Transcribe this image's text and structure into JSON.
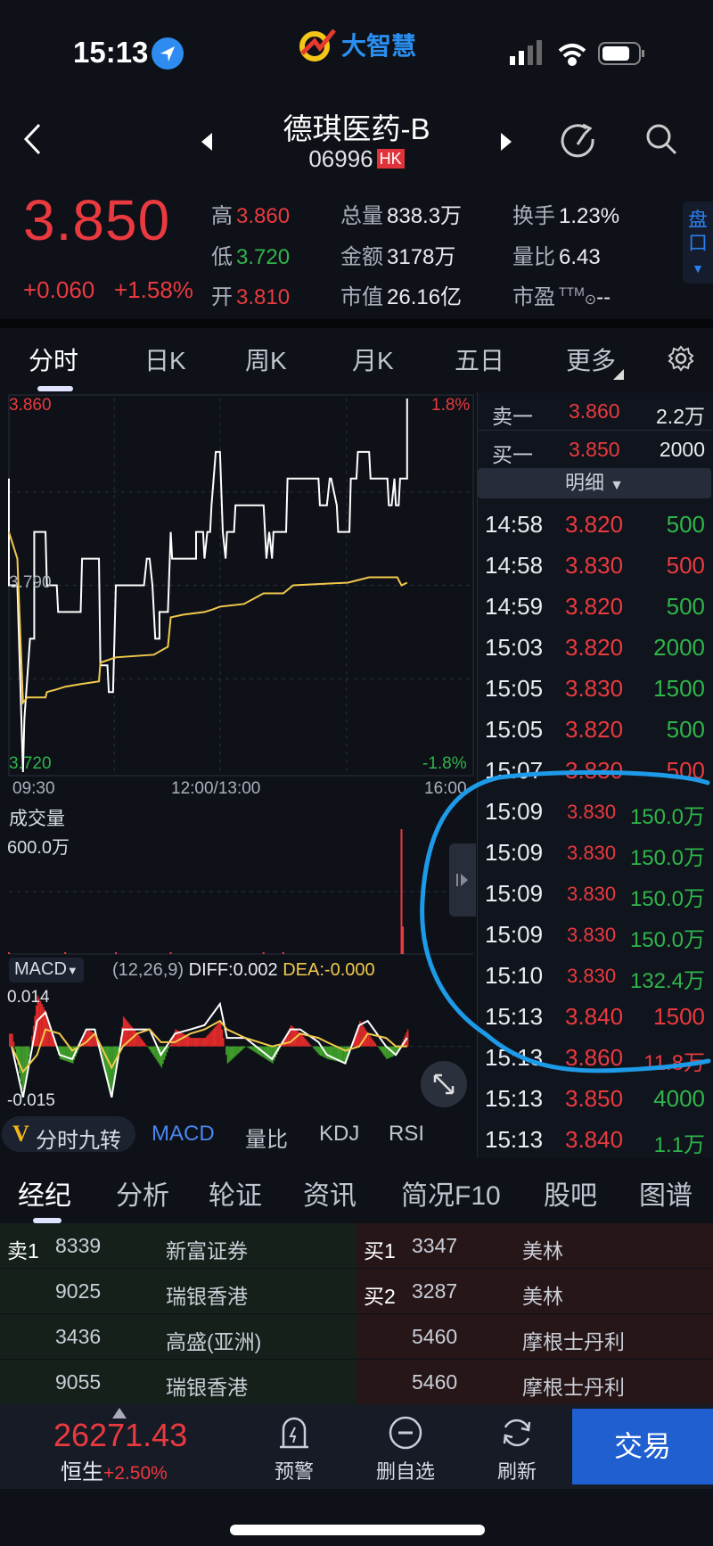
{
  "status": {
    "time": "15:13",
    "app_logo": "大智慧"
  },
  "header": {
    "name": "德琪医药-B",
    "code": "06996",
    "market": "HK"
  },
  "quote": {
    "price": "3.850",
    "change": "+0.060",
    "change_pct": "+1.58%",
    "stats": [
      {
        "label": "高",
        "value": "3.860",
        "color": "red"
      },
      {
        "label": "低",
        "value": "3.720",
        "color": "green"
      },
      {
        "label": "开",
        "value": "3.810",
        "color": "red"
      },
      {
        "label": "总量",
        "value": "838.3万",
        "color": "white"
      },
      {
        "label": "金额",
        "value": "3178万",
        "color": "white"
      },
      {
        "label": "市值",
        "value": "26.16亿",
        "color": "white"
      },
      {
        "label": "换手",
        "value": "1.23%",
        "color": "white"
      },
      {
        "label": "量比",
        "value": "6.43",
        "color": "white"
      },
      {
        "label": "市盈",
        "value": "--",
        "color": "white",
        "sup": "TTM"
      }
    ],
    "side_tab": "盘口"
  },
  "chart_tabs": [
    "分时",
    "日K",
    "周K",
    "月K",
    "五日",
    "更多"
  ],
  "chart_data": [
    {
      "type": "line",
      "y_labels": {
        "top": "3.860",
        "mid": "3.790",
        "bottom": "3.720",
        "top_pct": "1.8%",
        "bottom_pct": "-1.8%"
      },
      "x_labels": [
        "09:30",
        "12:00/13:00",
        "16:00"
      ],
      "ylim": [
        3.72,
        3.86
      ],
      "series": [
        {
          "color": "#ffffff",
          "points": [
            [
              "09:30",
              3.83
            ],
            [
              "09:30",
              3.79
            ],
            [
              "09:36",
              3.79
            ],
            [
              "09:40",
              3.72
            ],
            [
              "09:41",
              3.74
            ],
            [
              "09:45",
              3.77
            ],
            [
              "09:48",
              3.77
            ],
            [
              "09:48",
              3.81
            ],
            [
              "09:56",
              3.81
            ],
            [
              "09:57",
              3.79
            ],
            [
              "10:04",
              3.79
            ],
            [
              "10:05",
              3.78
            ],
            [
              "10:21",
              3.78
            ],
            [
              "10:22",
              3.8
            ],
            [
              "10:34",
              3.8
            ],
            [
              "10:35",
              3.76
            ],
            [
              "10:40",
              3.76
            ],
            [
              "10:41",
              3.75
            ],
            [
              "10:44",
              3.75
            ],
            [
              "10:46",
              3.79
            ],
            [
              "11:06",
              3.79
            ],
            [
              "11:08",
              3.8
            ],
            [
              "11:10",
              3.8
            ],
            [
              "11:12",
              3.79
            ],
            [
              "11:14",
              3.77
            ],
            [
              "11:17",
              3.77
            ],
            [
              "11:17",
              3.78
            ],
            [
              "11:23",
              3.78
            ],
            [
              "11:25",
              3.81
            ],
            [
              "11:26",
              3.8
            ],
            [
              "11:43",
              3.8
            ],
            [
              "11:43",
              3.81
            ],
            [
              "11:48",
              3.81
            ],
            [
              "11:49",
              3.8
            ],
            [
              "11:51",
              3.81
            ],
            [
              "11:53",
              3.81
            ],
            [
              "11:54",
              3.82
            ],
            [
              "11:57",
              3.84
            ],
            [
              "13:00",
              3.84
            ],
            [
              "13:02",
              3.81
            ],
            [
              "13:04",
              3.8
            ],
            [
              "13:05",
              3.81
            ],
            [
              "13:10",
              3.81
            ],
            [
              "13:11",
              3.82
            ],
            [
              "13:31",
              3.82
            ],
            [
              "13:33",
              3.8
            ],
            [
              "13:35",
              3.81
            ],
            [
              "13:37",
              3.8
            ],
            [
              "13:38",
              3.81
            ],
            [
              "13:47",
              3.81
            ],
            [
              "13:48",
              3.83
            ],
            [
              "14:10",
              3.83
            ],
            [
              "14:11",
              3.82
            ],
            [
              "14:16",
              3.82
            ],
            [
              "14:18",
              3.83
            ],
            [
              "14:19",
              3.83
            ],
            [
              "14:23",
              3.82
            ],
            [
              "14:24",
              3.81
            ],
            [
              "14:32",
              3.81
            ],
            [
              "14:33",
              3.83
            ],
            [
              "14:37",
              3.83
            ],
            [
              "14:38",
              3.84
            ],
            [
              "14:46",
              3.84
            ],
            [
              "14:47",
              3.83
            ],
            [
              "14:59",
              3.83
            ],
            [
              "15:00",
              3.82
            ],
            [
              "15:02",
              3.82
            ],
            [
              "15:04",
              3.83
            ],
            [
              "15:05",
              3.82
            ],
            [
              "15:07",
              3.82
            ],
            [
              "15:08",
              3.83
            ],
            [
              "15:13",
              3.83
            ],
            [
              "15:13",
              3.86
            ]
          ]
        },
        {
          "color": "#f2c94c",
          "points": [
            [
              "09:30",
              3.81
            ],
            [
              "09:36",
              3.8
            ],
            [
              "09:40",
              3.746
            ],
            [
              "09:43",
              3.748
            ],
            [
              "09:56",
              3.748
            ],
            [
              "09:57",
              3.75
            ],
            [
              "10:04",
              3.751
            ],
            [
              "10:10",
              3.752
            ],
            [
              "10:21",
              3.753
            ],
            [
              "10:34",
              3.754
            ],
            [
              "10:35",
              3.761
            ],
            [
              "10:46",
              3.763
            ],
            [
              "11:13",
              3.764
            ],
            [
              "11:23",
              3.767
            ],
            [
              "11:25",
              3.778
            ],
            [
              "11:34",
              3.779
            ],
            [
              "11:49",
              3.78
            ],
            [
              "11:55",
              3.781
            ],
            [
              "13:00",
              3.782
            ],
            [
              "13:17",
              3.783
            ],
            [
              "13:31",
              3.787
            ],
            [
              "13:45",
              3.787
            ],
            [
              "13:52",
              3.79
            ],
            [
              "14:31",
              3.791
            ],
            [
              "14:46",
              3.793
            ],
            [
              "15:06",
              3.793
            ],
            [
              "15:09",
              3.79
            ],
            [
              "15:13",
              3.791
            ]
          ]
        }
      ]
    },
    {
      "type": "bar",
      "title": "成交量",
      "max_label": "600.0万",
      "ylim": [
        0,
        600
      ],
      "color": "#ea3a3f",
      "bars": [
        [
          "09:30",
          5
        ],
        [
          "10:10",
          4
        ],
        [
          "10:46",
          8
        ],
        [
          "11:25",
          8
        ],
        [
          "13:31",
          6
        ],
        [
          "13:45",
          6
        ],
        [
          "15:09",
          600
        ],
        [
          "15:10",
          132
        ]
      ]
    },
    {
      "type": "bar",
      "title": "MACD",
      "params": "(12,26,9)",
      "diff_label": "DIFF:0.002",
      "dea_label": "DEA:-0.000",
      "y_labels": {
        "top": "0.014",
        "bottom": "-0.015"
      },
      "ylim": [
        -0.015,
        0.014
      ],
      "colors": {
        "up": "#e02a2a",
        "down": "#3f9e2a",
        "diff": "#ffffff",
        "dea": "#f2c94c"
      },
      "points": [
        [
          "09:32",
          0.003,
          0.0,
          0.0
        ],
        [
          "09:40",
          -0.012,
          -0.012,
          -0.006
        ],
        [
          "09:50",
          0.012,
          0.006,
          -0.002
        ],
        [
          "09:56",
          0.008,
          0.008,
          0.004
        ],
        [
          "10:06",
          -0.003,
          -0.002,
          0.003
        ],
        [
          "10:15",
          -0.004,
          -0.003,
          -0.001
        ],
        [
          "10:25",
          0.004,
          0.004,
          0.001
        ],
        [
          "10:31",
          0.003,
          0.004,
          0.003
        ],
        [
          "10:43",
          -0.012,
          -0.012,
          -0.005
        ],
        [
          "10:51",
          0.007,
          0.004,
          0.0
        ],
        [
          "11:01",
          0.003,
          0.004,
          0.003
        ],
        [
          "11:10",
          -0.001,
          0.004,
          0.004
        ],
        [
          "11:18",
          -0.005,
          -0.002,
          0.001
        ],
        [
          "11:28",
          0.004,
          0.003,
          0.001
        ],
        [
          "11:39",
          0.002,
          0.004,
          0.003
        ],
        [
          "11:49",
          0.002,
          0.005,
          0.004
        ],
        [
          "13:00",
          0.006,
          0.01,
          0.006
        ],
        [
          "13:05",
          -0.004,
          0.002,
          0.004
        ],
        [
          "13:18",
          0.0,
          0.002,
          0.002
        ],
        [
          "13:37",
          -0.004,
          -0.003,
          0.0
        ],
        [
          "13:50",
          0.005,
          0.004,
          0.001
        ],
        [
          "13:57",
          0.003,
          0.004,
          0.003
        ],
        [
          "14:10",
          -0.002,
          0.001,
          0.002
        ],
        [
          "14:16",
          -0.003,
          -0.002,
          0.001
        ],
        [
          "14:29",
          -0.004,
          -0.004,
          -0.001
        ],
        [
          "14:39",
          0.006,
          0.005,
          0.0
        ],
        [
          "14:45",
          0.003,
          0.006,
          0.003
        ],
        [
          "14:58",
          -0.003,
          0.0,
          0.002
        ],
        [
          "15:05",
          -0.002,
          -0.002,
          0.0
        ],
        [
          "15:13",
          0.004,
          0.002,
          0.0
        ]
      ]
    }
  ],
  "orderbook": {
    "sell1": {
      "label": "卖一",
      "price": "3.860",
      "vol": "2.2万"
    },
    "buy1": {
      "label": "买一",
      "price": "3.850",
      "vol": "2000"
    },
    "detail_label": "明细"
  },
  "trades": [
    {
      "time": "14:58",
      "price": "3.820",
      "vol": "500",
      "vol_color": "green"
    },
    {
      "time": "14:58",
      "price": "3.830",
      "vol": "500",
      "vol_color": "red"
    },
    {
      "time": "14:59",
      "price": "3.820",
      "vol": "500",
      "vol_color": "green"
    },
    {
      "time": "15:03",
      "price": "3.820",
      "vol": "2000",
      "vol_color": "green"
    },
    {
      "time": "15:05",
      "price": "3.830",
      "vol": "1500",
      "vol_color": "green"
    },
    {
      "time": "15:05",
      "price": "3.820",
      "vol": "500",
      "vol_color": "green"
    },
    {
      "time": "15:07",
      "price": "3.830",
      "vol": "500",
      "vol_color": "red"
    },
    {
      "time": "15:09",
      "price": "3.830",
      "vol": "150.0万",
      "vol_color": "green"
    },
    {
      "time": "15:09",
      "price": "3.830",
      "vol": "150.0万",
      "vol_color": "green"
    },
    {
      "time": "15:09",
      "price": "3.830",
      "vol": "150.0万",
      "vol_color": "green"
    },
    {
      "time": "15:09",
      "price": "3.830",
      "vol": "150.0万",
      "vol_color": "green"
    },
    {
      "time": "15:10",
      "price": "3.830",
      "vol": "132.4万",
      "vol_color": "green"
    },
    {
      "time": "15:13",
      "price": "3.840",
      "vol": "1500",
      "vol_color": "red"
    },
    {
      "time": "15:13",
      "price": "3.860",
      "vol": "11.8万",
      "vol_color": "red"
    },
    {
      "time": "15:13",
      "price": "3.850",
      "vol": "4000",
      "vol_color": "green"
    },
    {
      "time": "15:13",
      "price": "3.840",
      "vol": "1.1万",
      "vol_color": "green"
    }
  ],
  "indicator_tabs": [
    "分时九转",
    "MACD",
    "量比",
    "KDJ",
    "RSI"
  ],
  "lower_tabs": [
    "经纪",
    "分析",
    "轮证",
    "资讯",
    "简况F10",
    "股吧",
    "图谱"
  ],
  "brokers": {
    "sell": [
      [
        "卖1",
        "8339",
        "新富证券"
      ],
      [
        "",
        "9025",
        "瑞银香港"
      ],
      [
        "",
        "3436",
        "高盛(亚洲)"
      ],
      [
        "",
        "9055",
        "瑞银香港"
      ]
    ],
    "buy": [
      [
        "买1",
        "3347",
        "美林"
      ],
      [
        "买2",
        "3287",
        "美林"
      ],
      [
        "",
        "5460",
        "摩根士丹利"
      ],
      [
        "",
        "5460",
        "摩根士丹利"
      ]
    ]
  },
  "footer": {
    "index_value": "26271.43",
    "index_name": "恒生",
    "index_change": "+2.50%",
    "buttons": [
      "预警",
      "删自选",
      "刷新"
    ],
    "trade": "交易"
  },
  "colors": {
    "up": "#ea3a3f",
    "down": "#2fb54a",
    "accent": "#1f5fd0",
    "annotation": "#1d9be8"
  }
}
